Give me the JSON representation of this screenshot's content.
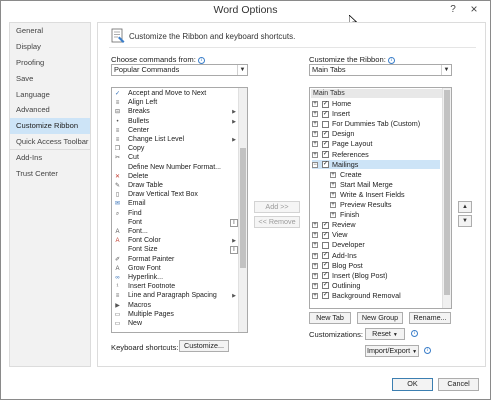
{
  "window": {
    "title": "Word Options",
    "help_icon": "?",
    "close_icon": "×"
  },
  "sidebar": {
    "items": [
      {
        "label": "General"
      },
      {
        "label": "Display"
      },
      {
        "label": "Proofing"
      },
      {
        "label": "Save"
      },
      {
        "label": "Language"
      },
      {
        "label": "Advanced"
      },
      {
        "label": "Customize Ribbon",
        "selected": true
      },
      {
        "label": "Quick Access Toolbar"
      },
      {
        "label": "Add-Ins"
      },
      {
        "label": "Trust Center"
      }
    ]
  },
  "main": {
    "header": "Customize the Ribbon and keyboard shortcuts.",
    "choose_label": "Choose commands from:",
    "choose_value": "Popular Commands",
    "customize_label": "Customize the Ribbon:",
    "customize_value": "Main Tabs",
    "commands": [
      {
        "label": "Accept and Move to Next",
        "icon": "accept-icon"
      },
      {
        "label": "Align Left",
        "icon": "align-left-icon"
      },
      {
        "label": "Breaks",
        "icon": "breaks-icon",
        "submenu": true
      },
      {
        "label": "Bullets",
        "icon": "bullets-icon",
        "submenu": true
      },
      {
        "label": "Center",
        "icon": "center-icon"
      },
      {
        "label": "Change List Level",
        "icon": "list-level-icon",
        "submenu": true
      },
      {
        "label": "Copy",
        "icon": "copy-icon"
      },
      {
        "label": "Cut",
        "icon": "cut-icon"
      },
      {
        "label": "Define New Number Format...",
        "icon": ""
      },
      {
        "label": "Delete",
        "icon": "delete-icon"
      },
      {
        "label": "Draw Table",
        "icon": "draw-table-icon"
      },
      {
        "label": "Draw Vertical Text Box",
        "icon": "text-box-icon"
      },
      {
        "label": "Email",
        "icon": "email-icon"
      },
      {
        "label": "Find",
        "icon": "find-icon"
      },
      {
        "label": "Font",
        "icon": "",
        "box": true
      },
      {
        "label": "Font...",
        "icon": "font-icon"
      },
      {
        "label": "Font Color",
        "icon": "font-color-icon",
        "submenu": true
      },
      {
        "label": "Font Size",
        "icon": "",
        "box": true
      },
      {
        "label": "Format Painter",
        "icon": "format-painter-icon"
      },
      {
        "label": "Grow Font",
        "icon": "grow-font-icon"
      },
      {
        "label": "Hyperlink...",
        "icon": "hyperlink-icon"
      },
      {
        "label": "Insert Footnote",
        "icon": "footnote-icon"
      },
      {
        "label": "Line and Paragraph Spacing",
        "icon": "line-spacing-icon",
        "submenu": true
      },
      {
        "label": "Macros",
        "icon": "macros-icon"
      },
      {
        "label": "Multiple Pages",
        "icon": "multiple-pages-icon"
      },
      {
        "label": "New",
        "icon": "new-icon"
      }
    ],
    "add_button": "Add >>",
    "remove_button": "<< Remove",
    "tree_header": "Main Tabs",
    "tabs": [
      {
        "label": "Home",
        "level": 0,
        "expander": "+",
        "checked": true
      },
      {
        "label": "Insert",
        "level": 0,
        "expander": "+",
        "checked": true
      },
      {
        "label": "For Dummies Tab (Custom)",
        "level": 0,
        "expander": "+",
        "checked": false
      },
      {
        "label": "Design",
        "level": 0,
        "expander": "+",
        "checked": true
      },
      {
        "label": "Page Layout",
        "level": 0,
        "expander": "+",
        "checked": true
      },
      {
        "label": "References",
        "level": 0,
        "expander": "+",
        "checked": true
      },
      {
        "label": "Mailings",
        "level": 0,
        "expander": "−",
        "checked": true,
        "selected": true
      },
      {
        "label": "Create",
        "level": 1,
        "expander": "+"
      },
      {
        "label": "Start Mail Merge",
        "level": 1,
        "expander": "+"
      },
      {
        "label": "Write & Insert Fields",
        "level": 1,
        "expander": "+"
      },
      {
        "label": "Preview Results",
        "level": 1,
        "expander": "+"
      },
      {
        "label": "Finish",
        "level": 1,
        "expander": "+"
      },
      {
        "label": "Review",
        "level": 0,
        "expander": "+",
        "checked": true
      },
      {
        "label": "View",
        "level": 0,
        "expander": "+",
        "checked": true
      },
      {
        "label": "Developer",
        "level": 0,
        "expander": "+",
        "checked": false
      },
      {
        "label": "Add-Ins",
        "level": 0,
        "expander": "+",
        "checked": true
      },
      {
        "label": "Blog Post",
        "level": 0,
        "expander": "+",
        "checked": true
      },
      {
        "label": "Insert (Blog Post)",
        "level": 0,
        "expander": "+",
        "checked": true
      },
      {
        "label": "Outlining",
        "level": 0,
        "expander": "+",
        "checked": true
      },
      {
        "label": "Background Removal",
        "level": 0,
        "expander": "+",
        "checked": true
      }
    ],
    "new_tab": "New Tab",
    "new_group": "New Group",
    "rename": "Rename...",
    "customizations_label": "Customizations:",
    "reset": "Reset",
    "import_export": "Import/Export",
    "keyboard_label": "Keyboard shortcuts:",
    "customize_button": "Customize...",
    "move_up": "▲",
    "move_down": "▼"
  },
  "footer": {
    "ok": "OK",
    "cancel": "Cancel"
  }
}
